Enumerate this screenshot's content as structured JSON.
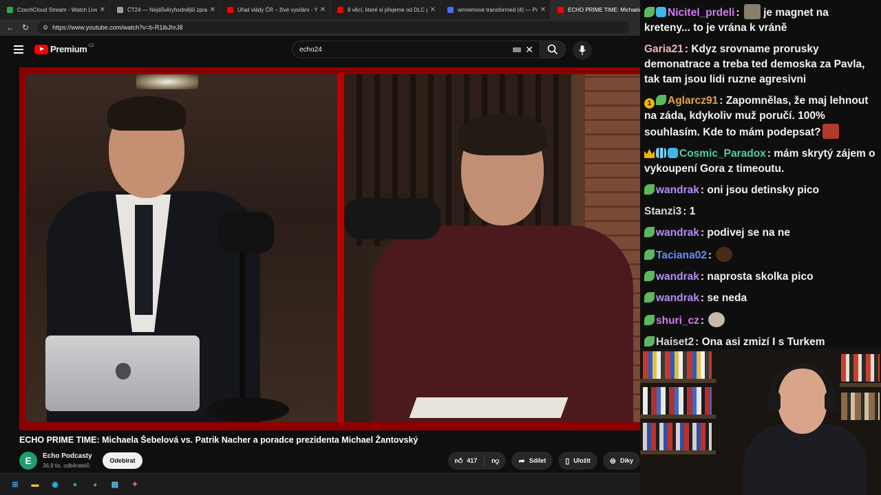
{
  "browser": {
    "tabs": [
      {
        "label": "CzechCloud Stream - Watch Live o",
        "color": "#2aa84a"
      },
      {
        "label": "ČT24 — Nejdůvěryhodnější zpravo",
        "color": "#9aa0a6"
      },
      {
        "label": "Úřad vlády ČR – živé vysílání - You",
        "color": "#ff0000"
      },
      {
        "label": "8 věcí, které si přejeme od DLC pro",
        "color": "#ff0000"
      },
      {
        "label": "wmremove transformed (4) — Po",
        "color": "#4a6cf7"
      },
      {
        "label": "ECHO PRIME TIME: Michaela Š",
        "color": "#ff0000"
      }
    ],
    "url": "https://www.youtube.com/watch?v=b-R1ibJhrJ8"
  },
  "youtube": {
    "logo_text": "Premium",
    "logo_region": "CZ",
    "search_value": "echo24"
  },
  "video": {
    "title": "ECHO PRIME TIME: Michaela Šebelová vs. Patrik Nacher a poradce prezidenta Michael Žantovský",
    "channel_name": "Echo Podcasty",
    "channel_initial": "E",
    "channel_subs": "36,9 tis. odběratelů",
    "subscribe_label": "Odebírat",
    "like_count": "417",
    "share_label": "Sdílet",
    "save_label": "Uložit",
    "thanks_label": "Díky"
  },
  "chat": [
    {
      "user": "Nicitel_prdeli",
      "user_color": "#d27cf5",
      "badges": [
        "b-green",
        "b-cube"
      ],
      "text": "je magnet na kreteny... to je vrána k vráně",
      "emote_before": true,
      "emote_color": "#8a7d6e"
    },
    {
      "user": "Garia21",
      "user_color": "#f2b5b5",
      "badges": [],
      "text": "Kdyz srovname prorusky demonatrace a treba ted demoska za Pavla, tak tam jsou lidi ruzne agresivni"
    },
    {
      "user": "Aglarcz91",
      "user_color": "#e5a24a",
      "badges": [
        "b-one",
        "b-green"
      ],
      "text": "Zapomnělas, že maj lehnout na záda, kdykoliv muž poručí. 100% souhlasím. Kde to mám podepsat?",
      "emote_after": true,
      "emote_color": "#b13a2a"
    },
    {
      "user": "Cosmic_Paradox",
      "user_color": "#4fd1a0",
      "badges": [
        "b-crown",
        "b-bars",
        "b-cube"
      ],
      "text": "mám skrytý zájem o vykoupení Gora z timeoutu."
    },
    {
      "user": "wandrak",
      "user_color": "#b58cf7",
      "badges": [
        "b-green"
      ],
      "text": "oni jsou detinsky pico"
    },
    {
      "user": "Stanzi3",
      "user_color": "#d8d8d8",
      "badges": [],
      "text": "1"
    },
    {
      "user": "wandrak",
      "user_color": "#b58cf7",
      "badges": [
        "b-green"
      ],
      "text": "podivej se na ne"
    },
    {
      "user": "Taciana02",
      "user_color": "#6a8cf7",
      "badges": [
        "b-green"
      ],
      "text": "",
      "emote_after": true,
      "emote_color": "#4a2a1a"
    },
    {
      "user": "wandrak",
      "user_color": "#b58cf7",
      "badges": [
        "b-green"
      ],
      "text": "naprosta skolka pico"
    },
    {
      "user": "wandrak",
      "user_color": "#b58cf7",
      "badges": [
        "b-green"
      ],
      "text": "se neda"
    },
    {
      "user": "shuri_cz",
      "user_color": "#d27cf5",
      "badges": [
        "b-green"
      ],
      "text": "",
      "emote_after": true,
      "emote_color": "#c8b8a8"
    },
    {
      "user": "Haiset2",
      "user_color": "#d8d8d8",
      "badges": [
        "b-green"
      ],
      "text": "Ona asi zmizí I s Turkem"
    }
  ],
  "taskbar": {
    "items": [
      {
        "name": "windows-start-icon",
        "glyph": "⊞",
        "color": "#3aa0f0"
      },
      {
        "name": "file-explorer-icon",
        "glyph": "▬",
        "color": "#f0c040"
      },
      {
        "name": "edge-browser-icon",
        "glyph": "◉",
        "color": "#2cb0e0"
      },
      {
        "name": "spotify-icon",
        "glyph": "●",
        "color": "#1db954"
      },
      {
        "name": "discord-icon",
        "glyph": "◕",
        "color": "#7289da"
      },
      {
        "name": "notepad-icon",
        "glyph": "▤",
        "color": "#6ad0f0"
      },
      {
        "name": "copilot-icon",
        "glyph": "✦",
        "color": "#e060c0"
      }
    ]
  }
}
